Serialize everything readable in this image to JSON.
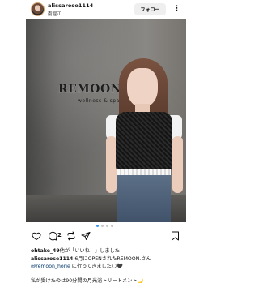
{
  "post": {
    "username": "alissarose1114",
    "location": "南堀江",
    "follow_label": "フォロー",
    "more_label": "⋮"
  },
  "photo": {
    "logo_text": "REMOON",
    "logo_subtext": "wellness & spa"
  },
  "carousel": {
    "count": 4,
    "active_index": 0
  },
  "actions": {
    "comment_count": "2"
  },
  "likes": {
    "user": "ohtake_49",
    "text": "他が「いいね！」しました"
  },
  "caption": {
    "user": "alissarose1114",
    "line1": " 6月にOPENされたREMOON.さん",
    "mention": "@remoon_horie",
    "line2": " に行ってきました🌕🖤",
    "line3": "私が受けたのは90分間の月光浴トリートメント🌙"
  },
  "colors": {
    "accent": "#3897f0",
    "mention": "#00376b",
    "follow_bg": "#efefef"
  },
  "icons": [
    "heart-icon",
    "comment-icon",
    "repost-icon",
    "send-icon",
    "bookmark-icon",
    "more-icon"
  ]
}
